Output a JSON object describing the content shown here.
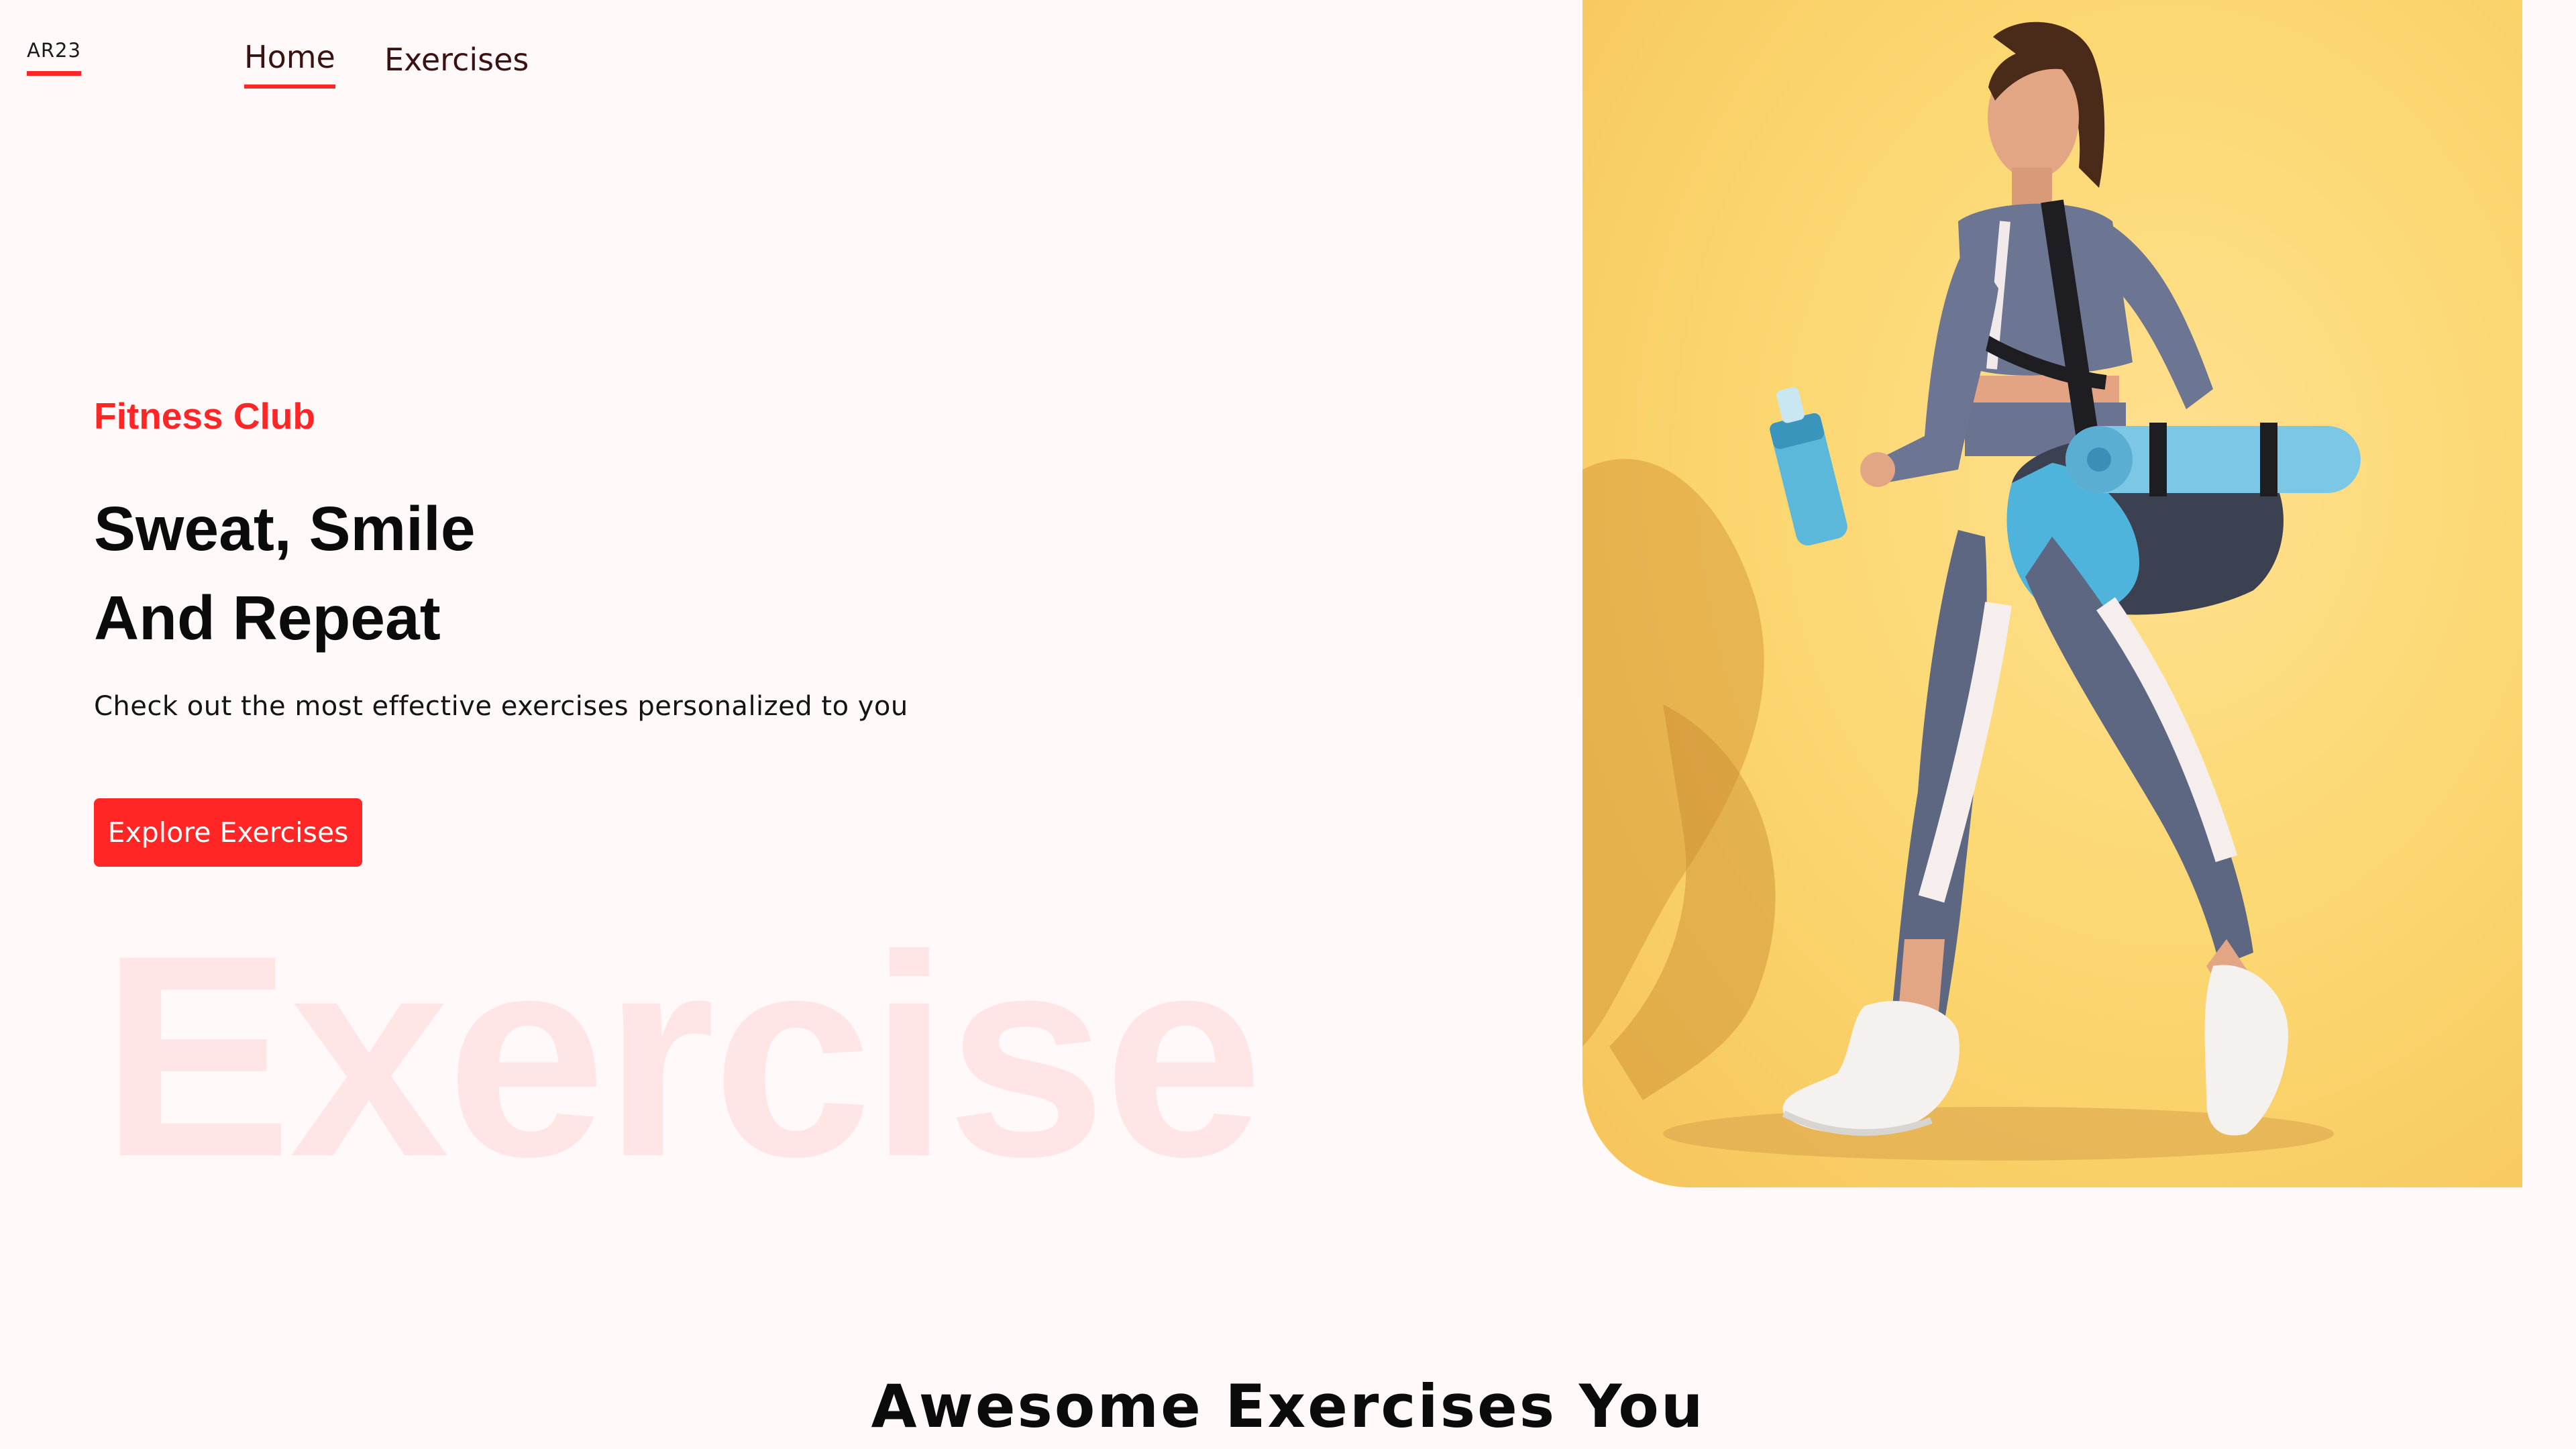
{
  "nav": {
    "logo_text": "AR23",
    "links": [
      {
        "label": "Home",
        "active": true
      },
      {
        "label": "Exercises",
        "active": false
      }
    ]
  },
  "hero": {
    "tag": "Fitness Club",
    "title_line1": "Sweat, Smile",
    "title_line2": "And Repeat",
    "subtitle": "Check out the most effective exercises personalized to you",
    "cta_label": "Explore Exercises",
    "watermark": "Exercise"
  },
  "section": {
    "heading": "Awesome Exercises You"
  },
  "colors": {
    "accent": "#ff2625",
    "background": "#fff9fa",
    "hero_image_bg": "#fcd872",
    "text": "#111111"
  }
}
